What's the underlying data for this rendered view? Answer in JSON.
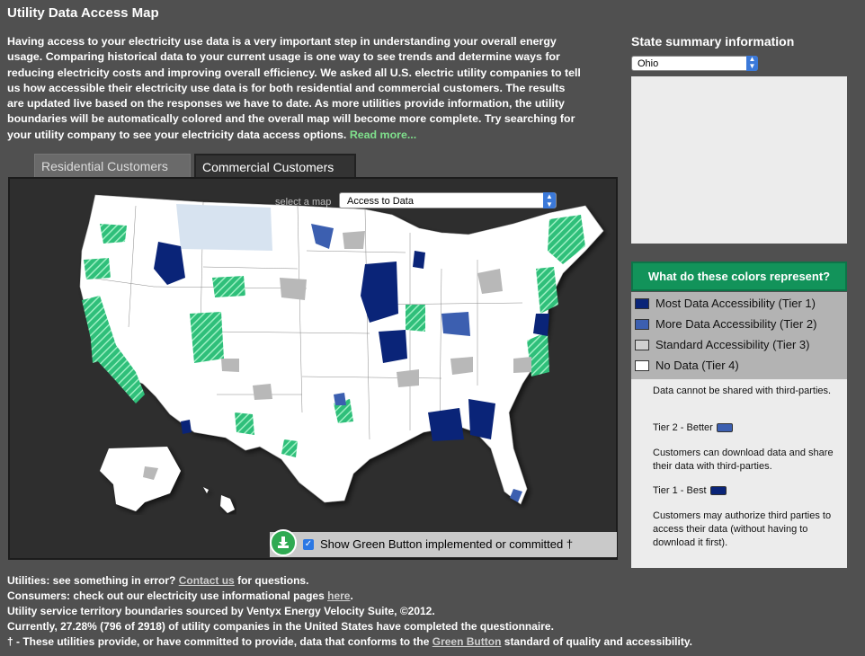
{
  "page": {
    "title": "Utility Data Access Map",
    "intro": "Having access to your electricity use data is a very important step in understanding your overall energy usage. Comparing historical data to your current usage is one way to see trends and determine ways for reducing electricity costs and improving overall efficiency. We asked all U.S. electric utility companies to tell us how accessible their electricity use data is for both residential and commercial customers. The results are updated live based on the responses we have to date. As more utilities provide information, the utility boundaries will be automatically colored and the overall map will become more complete. Try searching for your utility company to see your electricity data access options.",
    "read_more": "Read more..."
  },
  "tabs": [
    {
      "label": "Residential Customers",
      "active": false
    },
    {
      "label": "Commercial Customers",
      "active": true
    }
  ],
  "map": {
    "select_label": "select a map",
    "select_value": "Access to Data",
    "green_button_label": "Show Green Button implemented or committed †",
    "green_button_checked": true
  },
  "state_summary": {
    "title": "State summary information",
    "selected_state": "Ohio"
  },
  "legend": {
    "title": "What do these colors represent?",
    "items": [
      {
        "label": "Most Data Accessibility (Tier 1)",
        "color": "#0a2478"
      },
      {
        "label": "More Data Accessibility (Tier 2)",
        "color": "#3c5fb0"
      },
      {
        "label": "Standard Accessibility (Tier 3)",
        "color": "#d0d0d0"
      },
      {
        "label": "No Data (Tier 4)",
        "color": "#ffffff"
      }
    ],
    "notes": {
      "tier4_desc": "Data cannot be shared with third-parties.",
      "tier2_label": "Tier 2 - Better",
      "tier2_desc": "Customers can download data and share their data with third-parties.",
      "tier1_label": "Tier 1 - Best",
      "tier1_desc": "Customers may authorize third parties to access their data (without having to download it first)."
    }
  },
  "footer": {
    "line1_pre": "Utilities: see something in error?",
    "line1_link": "Contact us",
    "line1_post": "for questions.",
    "line2_pre": "Consumers: check out our electricity use informational pages",
    "line2_link": "here",
    "line2_post": ".",
    "line3": "Utility service territory boundaries sourced by Ventyx Energy Velocity Suite, ©2012.",
    "line4": "Currently, 27.28% (796 of 2918) of utility companies in the United States have completed the questionnaire.",
    "line5_pre": "† - These utilities provide, or have committed to provide, data that conforms to the",
    "line5_link": "Green Button",
    "line5_post": "standard of quality and accessibility."
  },
  "colors": {
    "green_button": "#2faa52",
    "legend_header": "#12935a",
    "green_hatch": "#3ecf86",
    "tier1": "#0a2478",
    "tier2": "#3c5fb0"
  }
}
